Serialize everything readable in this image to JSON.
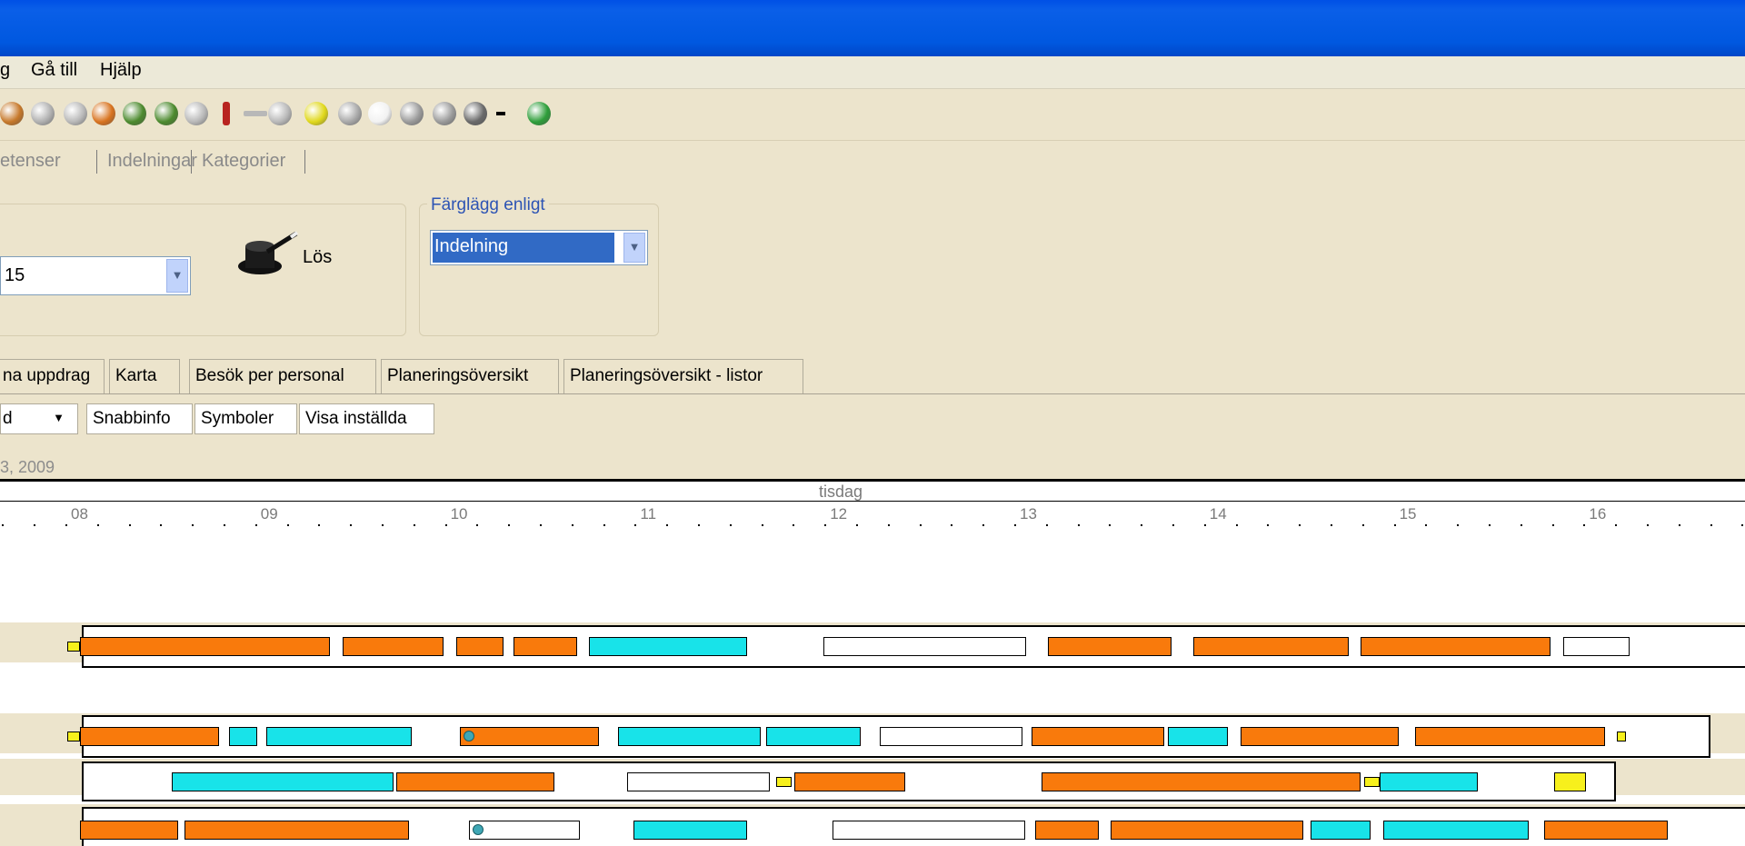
{
  "menu": {
    "items": [
      "g",
      "Gå till",
      "Hjälp"
    ]
  },
  "toolbar": {
    "icons": [
      {
        "name": "pencil-icon",
        "color": "#C6782A"
      },
      {
        "name": "tool-icon",
        "color": "#B0B0B0"
      },
      {
        "name": "person-grey-icon",
        "color": "#B8B8B8"
      },
      {
        "name": "person-pair-icon",
        "color": "#D8731F"
      },
      {
        "name": "person-money-icon",
        "color": "#4C8A2E"
      },
      {
        "name": "person-group-icon",
        "color": "#4C8A2E"
      },
      {
        "name": "people-grey-icon",
        "color": "#B8B8B8"
      },
      {
        "name": "pin-icon",
        "color": "#B82420"
      },
      {
        "name": "link-icon",
        "color": "#B8B8B8"
      },
      {
        "name": "person-arrow-icon",
        "color": "#B8B8B8"
      },
      {
        "name": "pause-icon",
        "color": "#E0D81C"
      },
      {
        "name": "stop-icon",
        "color": "#A8A8A8"
      },
      {
        "name": "hand-icon",
        "color": "#F2F2F2"
      },
      {
        "name": "group-grey-icon",
        "color": "#9A9A9A"
      },
      {
        "name": "gear-icon",
        "color": "#9A9A9A"
      },
      {
        "name": "print-icon",
        "color": "#6A6A6A"
      },
      {
        "name": "dropdown-arrow-icon",
        "color": "#000000"
      },
      {
        "name": "refresh-icon",
        "color": "#2E9E3A"
      }
    ]
  },
  "linkbar": {
    "items": [
      "etenser",
      "Indelningar",
      "Kategorier"
    ]
  },
  "panel": {
    "period_value": "15",
    "solve_label": "Lös",
    "color_group_legend": "Färglägg enligt",
    "color_by_value": "Indelning"
  },
  "tabs": [
    "na uppdrag",
    "Karta",
    "Besök per personal",
    "Planeringsöversikt",
    "Planeringsöversikt - listor"
  ],
  "subtoolbar": {
    "filter_value": "d",
    "buttons": [
      "Snabbinfo",
      "Symboler",
      "Visa inställda"
    ]
  },
  "date_label": "3, 2009",
  "timeline": {
    "day": "tisdag",
    "hours": [
      "08",
      "09",
      "10",
      "11",
      "12",
      "13",
      "14",
      "15",
      "16"
    ]
  },
  "colors": {
    "orange": "#F97A0C",
    "cyan": "#18E3E9",
    "white": "#FFFFFF",
    "yellow": "#F7F01C"
  },
  "schedule_rows": [
    {
      "bars": [
        {
          "start": "07:56",
          "end": "08:00",
          "color": "yellow"
        },
        {
          "start": "08:00",
          "end": "09:19",
          "color": "orange"
        },
        {
          "start": "09:23",
          "end": "09:55",
          "color": "orange"
        },
        {
          "start": "09:59",
          "end": "10:14",
          "color": "orange"
        },
        {
          "start": "10:17",
          "end": "10:37",
          "color": "orange"
        },
        {
          "start": "10:41",
          "end": "11:31",
          "color": "cyan"
        },
        {
          "start": "11:55",
          "end": "12:59",
          "color": "white"
        },
        {
          "start": "13:06",
          "end": "13:45",
          "color": "orange"
        },
        {
          "start": "13:52",
          "end": "14:41",
          "color": "orange"
        },
        {
          "start": "14:45",
          "end": "15:45",
          "color": "orange"
        },
        {
          "start": "15:49",
          "end": "16:10",
          "color": "white"
        }
      ]
    },
    {
      "bars": [
        {
          "start": "07:56",
          "end": "08:00",
          "color": "yellow"
        },
        {
          "start": "08:00",
          "end": "08:44",
          "color": "orange"
        },
        {
          "start": "08:47",
          "end": "08:56",
          "color": "cyan"
        },
        {
          "start": "08:59",
          "end": "09:45",
          "color": "cyan"
        },
        {
          "start": "10:00",
          "end": "10:44",
          "color": "orange"
        },
        {
          "start": "10:50",
          "end": "11:35",
          "color": "cyan"
        },
        {
          "start": "11:37",
          "end": "12:07",
          "color": "cyan"
        },
        {
          "start": "12:13",
          "end": "12:58",
          "color": "white"
        },
        {
          "start": "13:01",
          "end": "13:43",
          "color": "orange"
        },
        {
          "start": "13:44",
          "end": "14:03",
          "color": "cyan"
        },
        {
          "start": "14:07",
          "end": "14:57",
          "color": "orange"
        },
        {
          "start": "15:02",
          "end": "16:02",
          "color": "orange"
        },
        {
          "start": "16:06",
          "end": "16:09",
          "color": "yellow"
        }
      ]
    },
    {
      "bars": [
        {
          "start": "08:29",
          "end": "09:39",
          "color": "cyan"
        },
        {
          "start": "09:40",
          "end": "10:30",
          "color": "orange"
        },
        {
          "start": "10:53",
          "end": "11:38",
          "color": "white"
        },
        {
          "start": "11:40",
          "end": "11:45",
          "color": "yellow"
        },
        {
          "start": "11:46",
          "end": "12:21",
          "color": "orange"
        },
        {
          "start": "13:04",
          "end": "14:45",
          "color": "orange"
        },
        {
          "start": "14:46",
          "end": "14:51",
          "color": "yellow"
        },
        {
          "start": "14:51",
          "end": "15:22",
          "color": "cyan"
        },
        {
          "start": "15:46",
          "end": "15:56",
          "color": "yellow"
        }
      ]
    },
    {
      "bars": [
        {
          "start": "08:00",
          "end": "08:31",
          "color": "orange"
        },
        {
          "start": "08:33",
          "end": "09:44",
          "color": "orange"
        },
        {
          "start": "10:03",
          "end": "10:38",
          "color": "white"
        },
        {
          "start": "10:55",
          "end": "11:31",
          "color": "cyan"
        },
        {
          "start": "11:58",
          "end": "12:59",
          "color": "white"
        },
        {
          "start": "13:02",
          "end": "13:22",
          "color": "orange"
        },
        {
          "start": "13:26",
          "end": "14:27",
          "color": "orange"
        },
        {
          "start": "14:29",
          "end": "14:48",
          "color": "cyan"
        },
        {
          "start": "14:52",
          "end": "15:38",
          "color": "cyan"
        },
        {
          "start": "15:43",
          "end": "16:22",
          "color": "orange"
        }
      ]
    }
  ]
}
